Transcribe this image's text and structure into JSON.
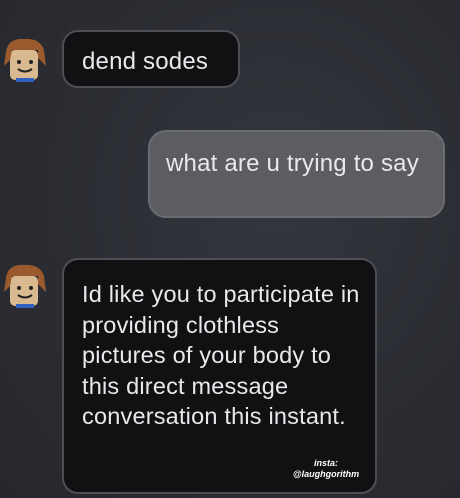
{
  "messages": [
    {
      "side": "received",
      "text": "dend sodes"
    },
    {
      "side": "sent",
      "text": "what are u trying to say"
    },
    {
      "side": "received",
      "text": "Id like you to participate in providing clothless pictures of your body to this direct message conversation this instant."
    }
  ],
  "watermark": {
    "line1": "insta:",
    "line2": "@laughgorithm"
  },
  "colors": {
    "background": "#2c2e35",
    "received_bubble": "#111114",
    "sent_bubble": "#5b5d63",
    "text": "#e9e9ec"
  },
  "icons": {
    "avatar": "roblox-noob-avatar-icon"
  }
}
